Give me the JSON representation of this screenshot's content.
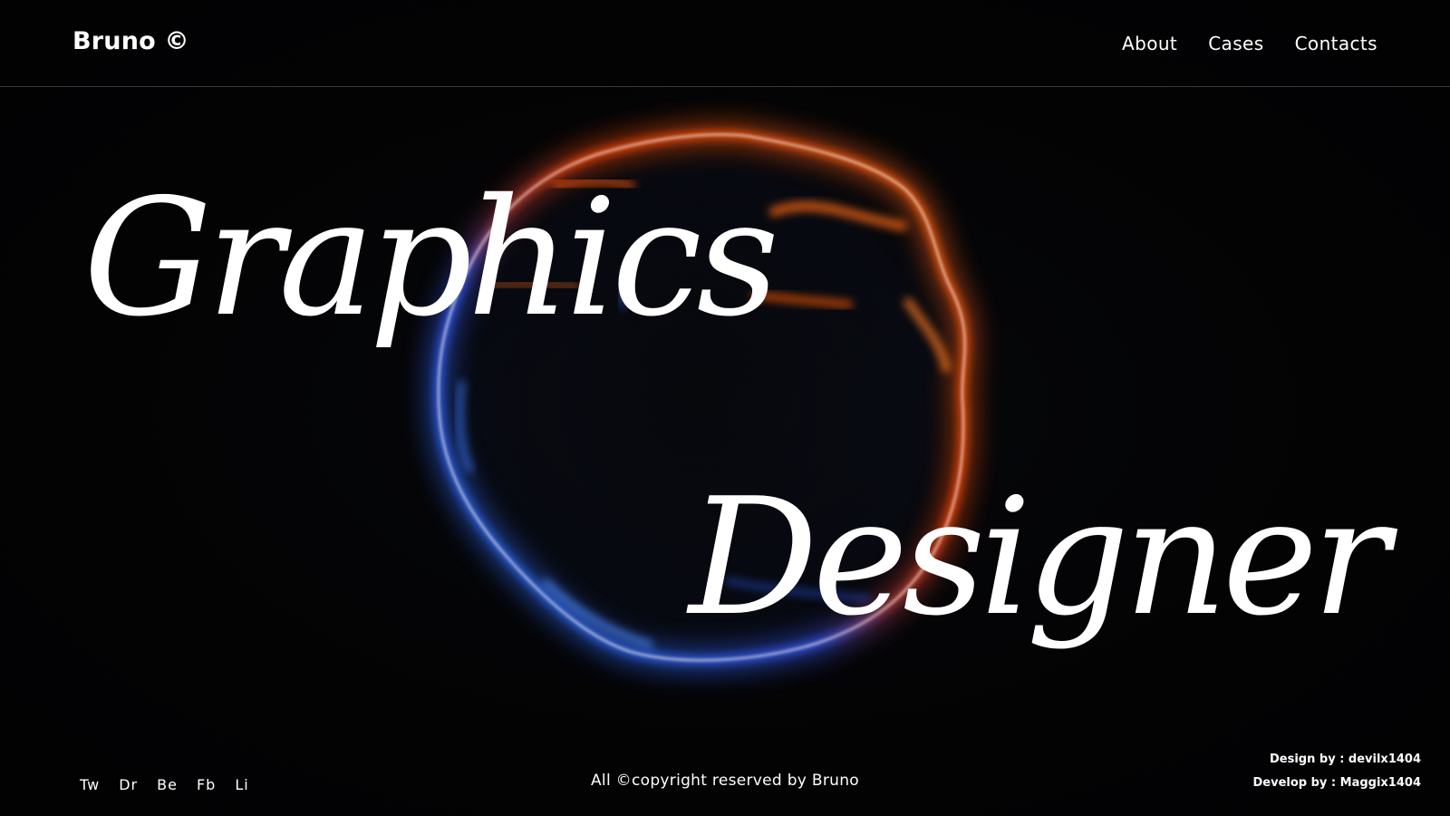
{
  "header": {
    "logo": "Bruno ©",
    "nav": [
      {
        "label": "About"
      },
      {
        "label": "Cases"
      },
      {
        "label": "Contacts"
      }
    ]
  },
  "hero": {
    "line1": "Graphics",
    "line2": "Designer"
  },
  "footer": {
    "socials": [
      {
        "label": "Tw"
      },
      {
        "label": "Dr"
      },
      {
        "label": "Be"
      },
      {
        "label": "Fb"
      },
      {
        "label": "Li"
      }
    ],
    "copyright": "All ©copyright reserved by Bruno",
    "design_credit": "Design by : devilx1404",
    "develop_credit": "Develop by : Maggix1404"
  },
  "colors": {
    "background": "#030304",
    "ring_warm": "#ff5a10",
    "ring_cool": "#2f6dff",
    "text": "#ffffff"
  }
}
